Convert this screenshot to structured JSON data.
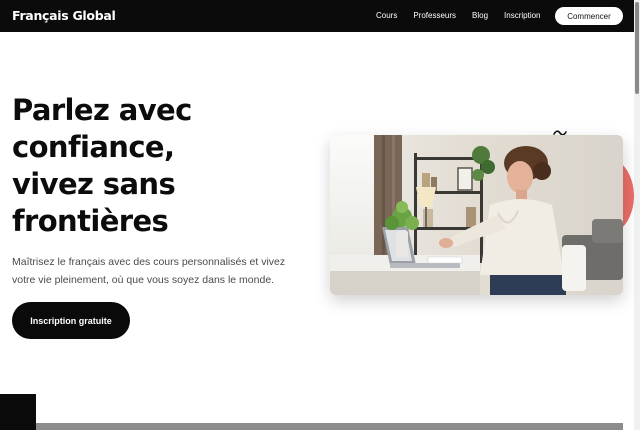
{
  "header": {
    "logo": "Français Global",
    "nav": [
      "Cours",
      "Professeurs",
      "Blog",
      "Inscription"
    ],
    "cta": "Commencer"
  },
  "hero": {
    "title_lines": [
      "Parlez avec",
      "confiance,",
      "vivez sans",
      "frontières"
    ],
    "subtitle": "Maîtrisez le français avec des cours personnalisés et vivez votre vie pleinement, où que vous soyez dans le monde.",
    "cta": "Inscription gratuite"
  },
  "colors": {
    "header_bg": "#0b0b0b",
    "accent": "#ea6d67",
    "text": "#0c0c0c",
    "muted_text": "#4a4a4a"
  }
}
